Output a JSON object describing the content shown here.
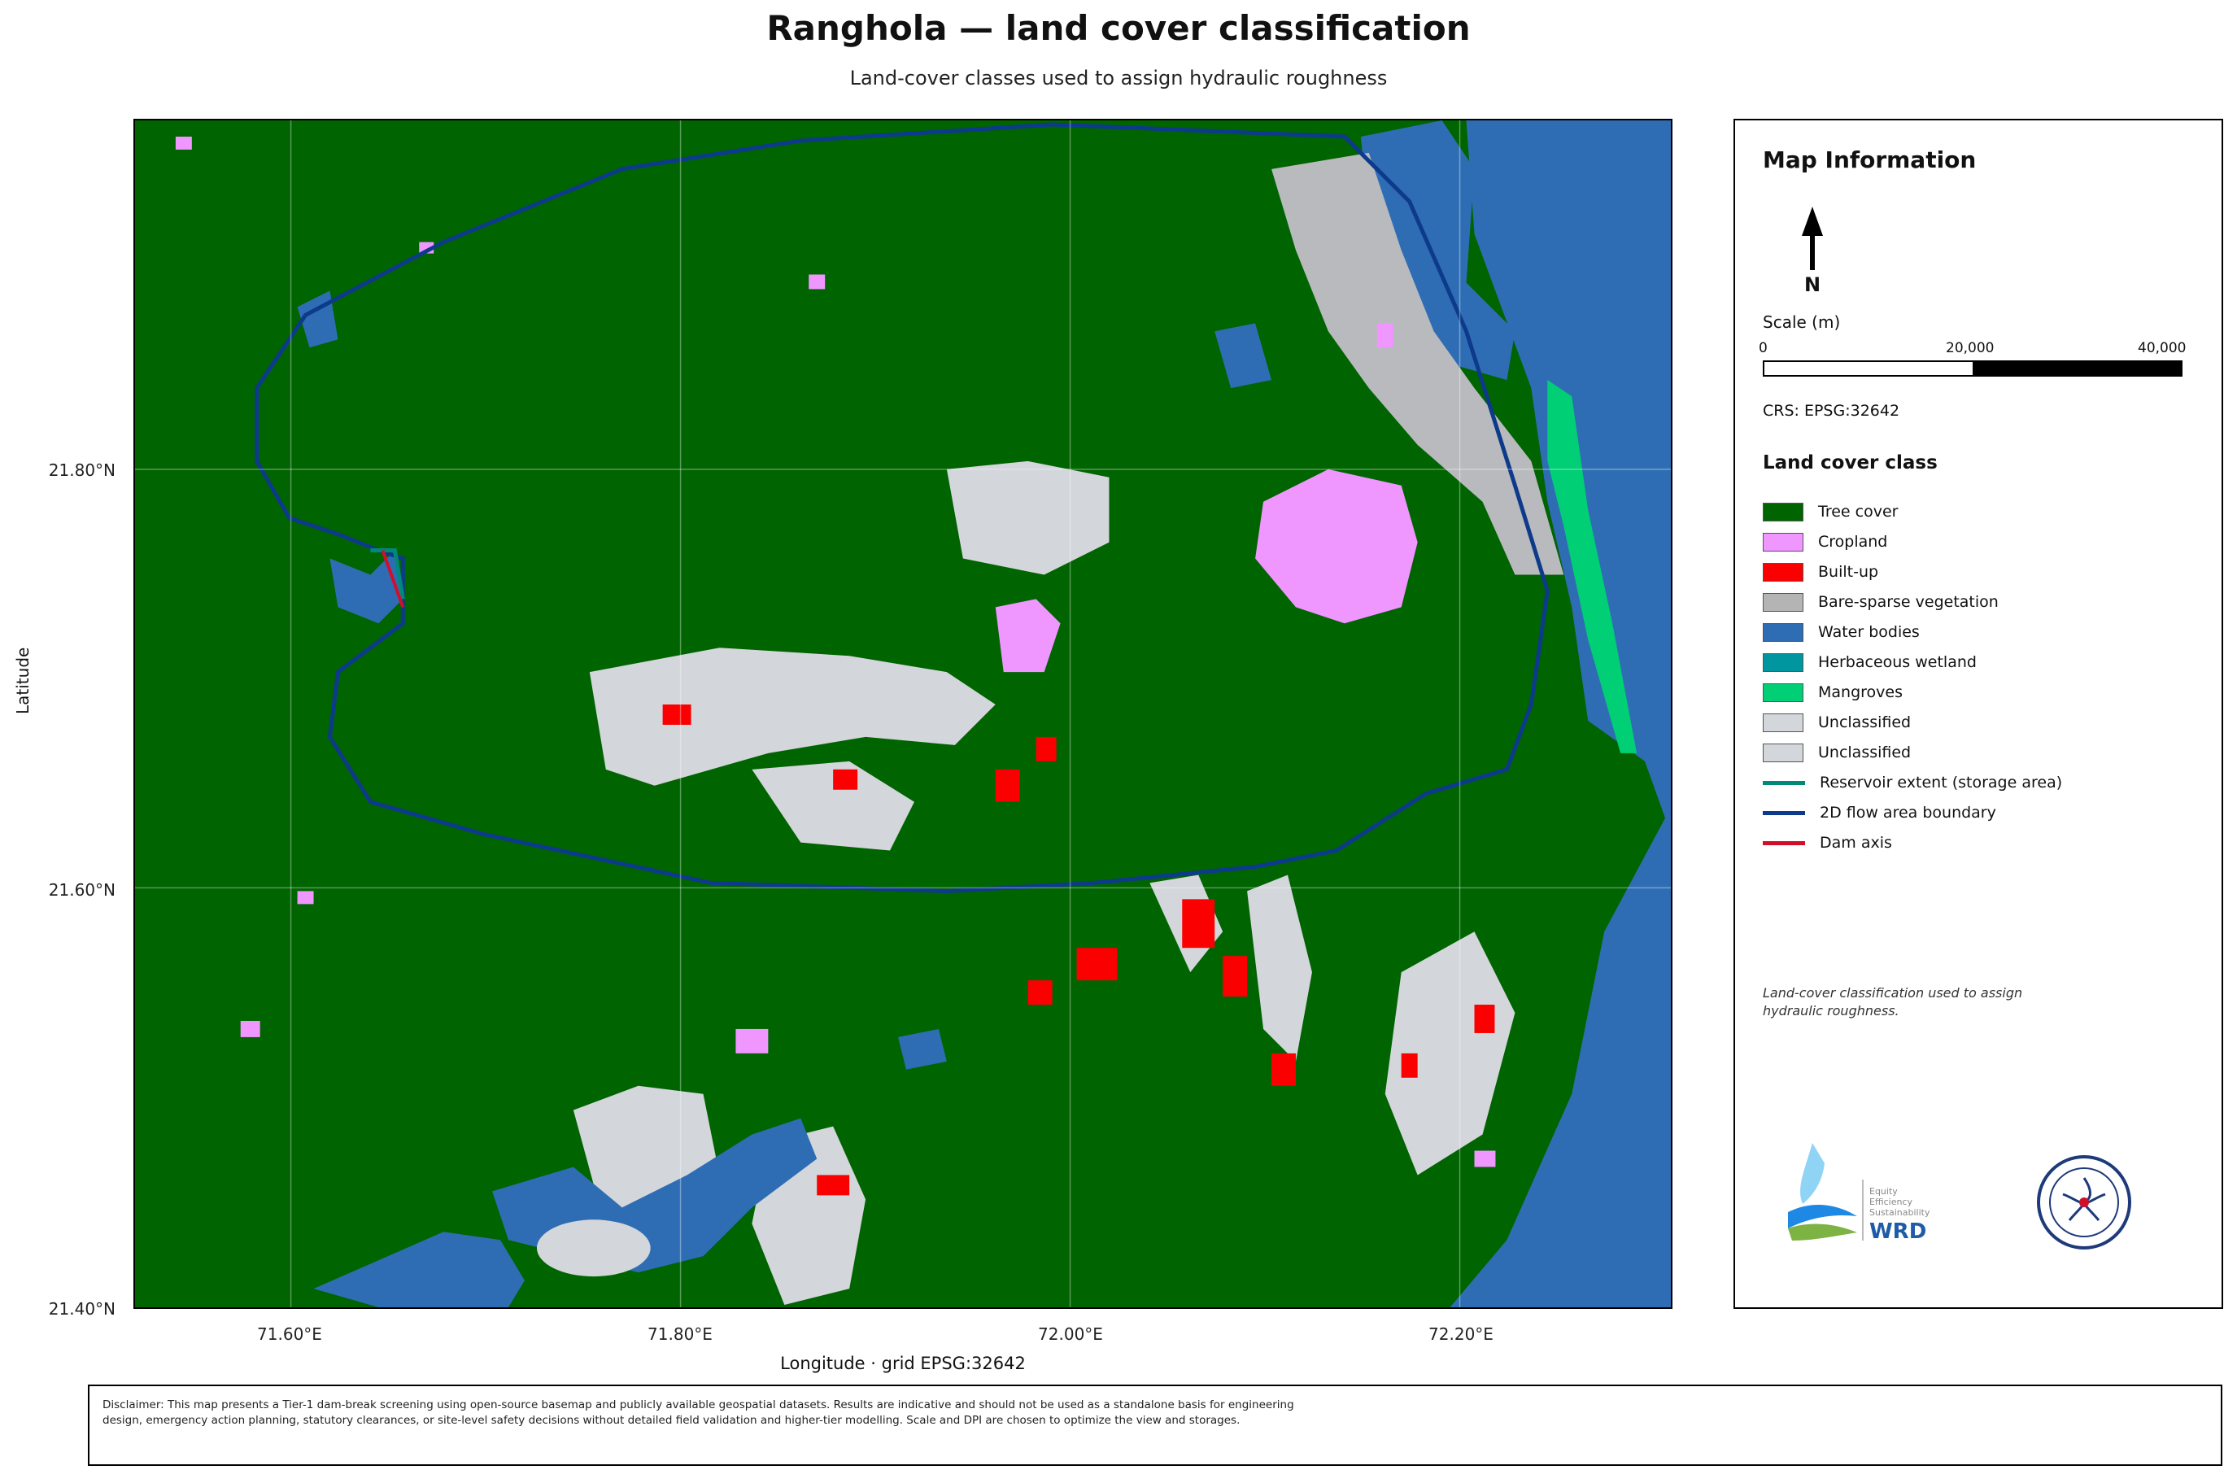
{
  "title": "Ranghola — land cover classification",
  "subtitle": "Land-cover classes used to assign hydraulic roughness",
  "map": {
    "x_ticks": [
      "71.60°E",
      "71.80°E",
      "72.00°E",
      "72.20°E"
    ],
    "y_ticks": [
      "21.80°N",
      "21.60°N",
      "21.40°N"
    ],
    "xlabel": "Longitude   ·   grid EPSG:32642",
    "ylabel": "Latitude",
    "extent": {
      "lon": [
        71.52,
        72.31
      ],
      "lat": [
        21.4,
        21.965
      ]
    }
  },
  "info_panel": {
    "title": "Map Information",
    "north_label": "N",
    "scale_title": "Scale (m)",
    "scale_labels": [
      "0",
      "20,000",
      "40,000"
    ],
    "crs": "CRS: EPSG:32642",
    "legend_title": "Land cover class",
    "legend": [
      {
        "label": "Tree cover",
        "color": "#006400",
        "kind": "fill"
      },
      {
        "label": "Cropland",
        "color": "#f096ff",
        "kind": "fill"
      },
      {
        "label": "Built-up",
        "color": "#fa0000",
        "kind": "fill"
      },
      {
        "label": "Bare-sparse vegetation",
        "color": "#b4b4b4",
        "kind": "fill"
      },
      {
        "label": "Water bodies",
        "color": "#2e6db4",
        "kind": "fill"
      },
      {
        "label": "Herbaceous wetland",
        "color": "#0096a0",
        "kind": "fill"
      },
      {
        "label": "Mangroves",
        "color": "#00cf75",
        "kind": "fill"
      },
      {
        "label": "Unclassified",
        "color": "#d3d6da",
        "kind": "fill"
      },
      {
        "label": "Unclassified",
        "color": "#d3d6da",
        "kind": "fill"
      },
      {
        "label": "Reservoir extent (storage area)",
        "color": "#00897b",
        "kind": "line"
      },
      {
        "label": "2D flow area boundary",
        "color": "#0d3a8a",
        "kind": "line"
      },
      {
        "label": "Dam axis",
        "color": "#d0102a",
        "kind": "line"
      }
    ],
    "note": "Land-cover classification used to assign hydraulic roughness.",
    "logo_text": [
      "Equity",
      "Efficiency",
      "Sustainability",
      "WRD"
    ]
  },
  "disclaimer": "Disclaimer: This map presents a Tier-1 dam-break screening using open-source basemap and publicly available geospatial datasets. Results are indicative and should not be used as a standalone basis for engineering design, emergency action planning, statutory clearances, or site-level safety decisions without detailed field validation and higher-tier modelling. Scale and DPI are chosen to optimize the view and storages."
}
